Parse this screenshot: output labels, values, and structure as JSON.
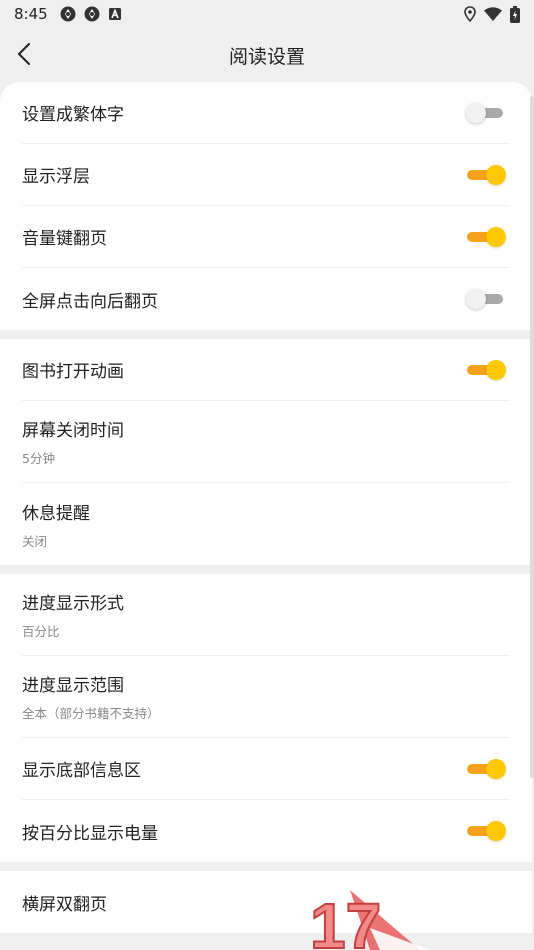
{
  "status_bar": {
    "time": "8:45",
    "icons": [
      "aperture-icon",
      "aperture-icon",
      "a-badge-icon",
      "location-icon",
      "wifi-icon",
      "battery-icon"
    ]
  },
  "header": {
    "title": "阅读设置"
  },
  "groups": [
    {
      "items": [
        {
          "label": "设置成繁体字",
          "type": "switch",
          "state": "off"
        },
        {
          "label": "显示浮层",
          "type": "switch",
          "state": "on"
        },
        {
          "label": "音量键翻页",
          "type": "switch",
          "state": "on"
        },
        {
          "label": "全屏点击向后翻页",
          "type": "switch",
          "state": "off"
        }
      ]
    },
    {
      "items": [
        {
          "label": "图书打开动画",
          "type": "switch",
          "state": "on"
        },
        {
          "label": "屏幕关闭时间",
          "type": "value",
          "value": "5分钟"
        },
        {
          "label": "休息提醒",
          "type": "value",
          "value": "关闭"
        }
      ]
    },
    {
      "items": [
        {
          "label": "进度显示形式",
          "type": "value",
          "value": "百分比"
        },
        {
          "label": "进度显示范围",
          "type": "value",
          "value": "全本（部分书籍不支持）"
        },
        {
          "label": "显示底部信息区",
          "type": "switch",
          "state": "on"
        },
        {
          "label": "按百分比显示电量",
          "type": "switch",
          "state": "on"
        }
      ]
    },
    {
      "items": [
        {
          "label": "横屏双翻页",
          "type": "plain"
        }
      ]
    }
  ],
  "watermark": {
    "text": "17"
  },
  "colors": {
    "accent": "#ffc800",
    "accent_track": "#f7a21d",
    "off_track": "#a9a9a9",
    "background": "#efefef"
  }
}
